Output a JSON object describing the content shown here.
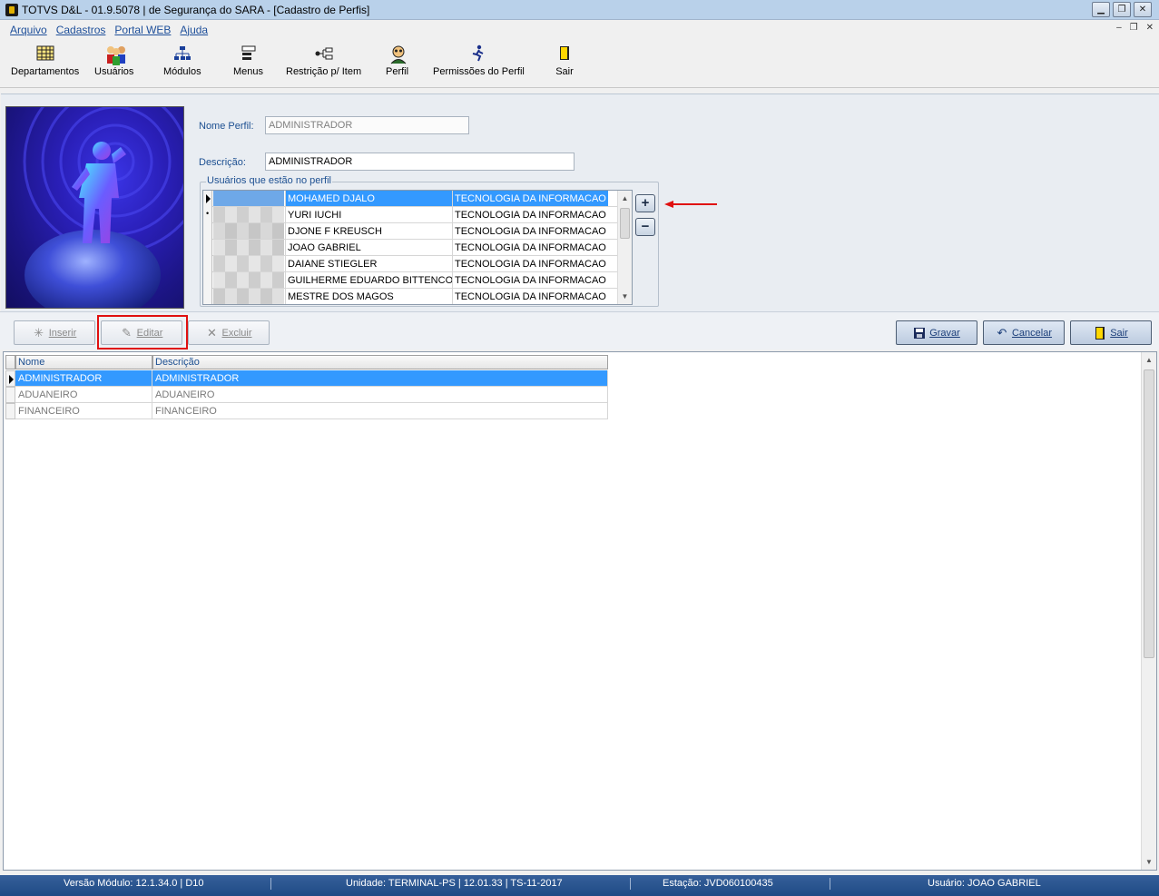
{
  "window": {
    "title": "TOTVS D&L - 01.9.5078 | de Segurança do SARA - [Cadastro de Perfis]",
    "controls": [
      "minimize",
      "restore",
      "close"
    ]
  },
  "menubar": {
    "items": [
      "Arquivo",
      "Cadastros",
      "Portal WEB",
      "Ajuda"
    ]
  },
  "toolbar": {
    "items": [
      {
        "label": "Departamentos",
        "icon": "grid-table-icon"
      },
      {
        "label": "Usuários",
        "icon": "users-group-icon"
      },
      {
        "label": "Módulos",
        "icon": "module-tree-icon"
      },
      {
        "label": "Menus",
        "icon": "menu-list-icon"
      },
      {
        "label": "Restrição p/ Item",
        "icon": "restriction-network-icon"
      },
      {
        "label": "Perfil",
        "icon": "profile-person-icon"
      },
      {
        "label": "Permissões do Perfil",
        "icon": "running-person-icon"
      },
      {
        "label": "Sair",
        "icon": "exit-door-icon"
      }
    ]
  },
  "form": {
    "nome_perfil_label": "Nome Perfil:",
    "nome_perfil_value": "ADMINISTRADOR",
    "descricao_label": "Descrição:",
    "descricao_value": "ADMINISTRADOR",
    "users_group_label": "Usuários que estão no perfil",
    "users": [
      {
        "name": "MOHAMED DJALO",
        "department": "TECNOLOGIA DA INFORMACAO",
        "selected": true
      },
      {
        "name": "YURI IUCHI",
        "department": "TECNOLOGIA DA INFORMACAO",
        "selected": false
      },
      {
        "name": "DJONE F KREUSCH",
        "department": "TECNOLOGIA DA INFORMACAO",
        "selected": false
      },
      {
        "name": "JOAO GABRIEL",
        "department": "TECNOLOGIA DA INFORMACAO",
        "selected": false
      },
      {
        "name": "DAIANE STIEGLER",
        "department": "TECNOLOGIA DA INFORMACAO",
        "selected": false
      },
      {
        "name": "GUILHERME EDUARDO BITTENCOURT",
        "department": "TECNOLOGIA DA INFORMACAO",
        "selected": false
      },
      {
        "name": "MESTRE DOS MAGOS",
        "department": "TECNOLOGIA DA INFORMACAO",
        "selected": false
      }
    ],
    "add_user_symbol": "+",
    "remove_user_symbol": "−"
  },
  "actions": {
    "inserir": "Inserir",
    "editar": "Editar",
    "excluir": "Excluir",
    "gravar": "Gravar",
    "cancelar": "Cancelar",
    "sair": "Sair"
  },
  "profiles_grid": {
    "columns": [
      "Nome",
      "Descrição"
    ],
    "rows": [
      {
        "nome": "ADMINISTRADOR",
        "descricao": "ADMINISTRADOR",
        "selected": true
      },
      {
        "nome": "ADUANEIRO",
        "descricao": "ADUANEIRO",
        "selected": false
      },
      {
        "nome": "FINANCEIRO",
        "descricao": "FINANCEIRO",
        "selected": false
      }
    ]
  },
  "statusbar": {
    "versao": "Versão Módulo:  12.1.34.0  |  D10",
    "unidade": "Unidade: TERMINAL-PS | 12.01.33 | TS-11-2017",
    "estacao": "Estação: JVD060100435",
    "usuario": "Usuário: JOAO GABRIEL"
  },
  "colors": {
    "selection": "#3399ff",
    "label_blue": "#1c4f91",
    "highlight_red": "#e01010",
    "statusbar": "#1f4b85"
  }
}
